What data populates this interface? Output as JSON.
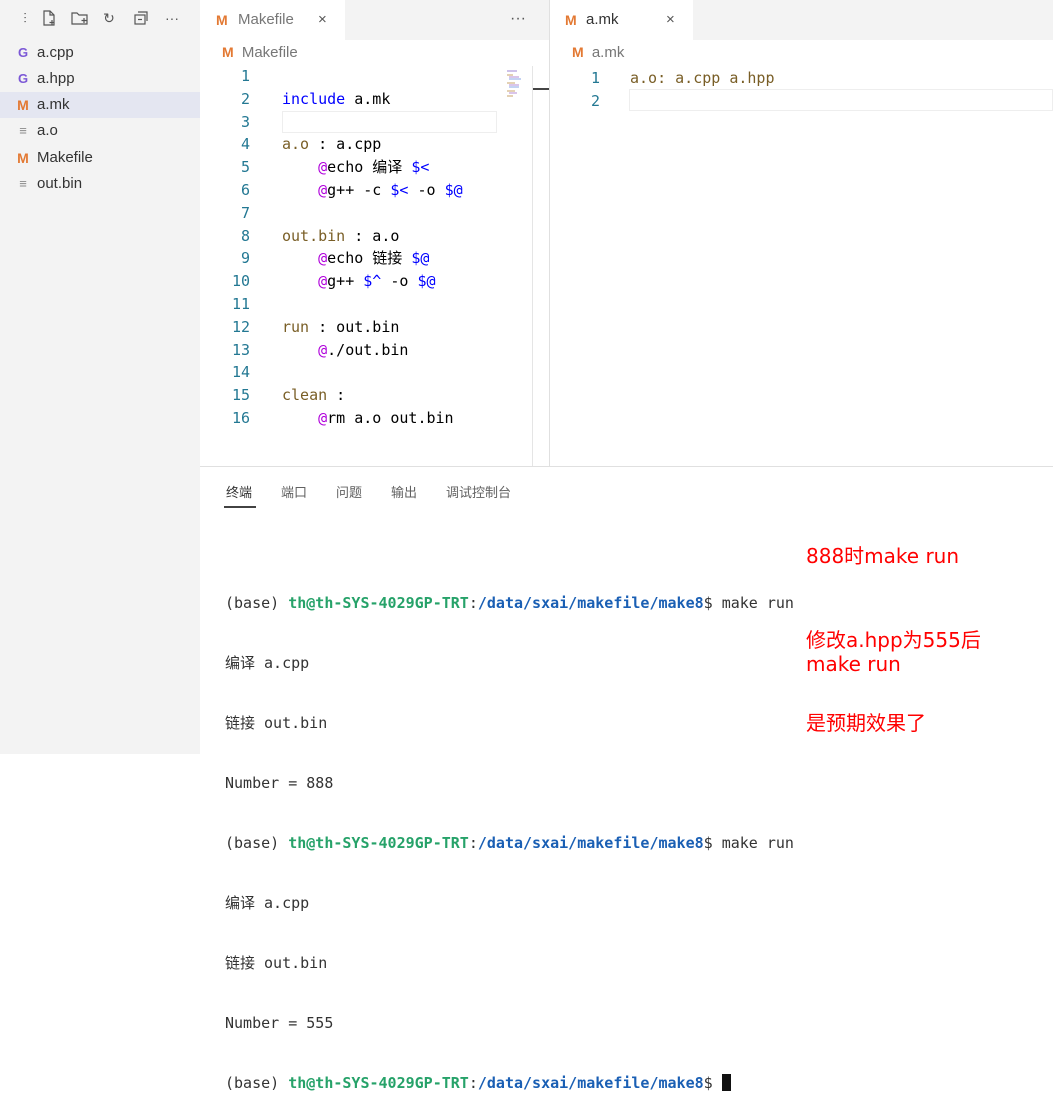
{
  "sidebar": {
    "toolbar_icons": [
      "collapse-icon",
      "new-file-icon",
      "new-folder-icon",
      "refresh-icon",
      "collapse-all-icon",
      "more-icon"
    ],
    "files": [
      {
        "label": "a.cpp",
        "icon": "c",
        "icon_glyph": "G"
      },
      {
        "label": "a.hpp",
        "icon": "c",
        "icon_glyph": "G"
      },
      {
        "label": "a.mk",
        "icon": "m",
        "icon_glyph": "M",
        "selected": true
      },
      {
        "label": "a.o",
        "icon": "t",
        "icon_glyph": "≡"
      },
      {
        "label": "Makefile",
        "icon": "m",
        "icon_glyph": "M"
      },
      {
        "label": "out.bin",
        "icon": "t",
        "icon_glyph": "≡"
      }
    ]
  },
  "editor_left": {
    "tab_label": "Makefile",
    "tab_icon": "M",
    "close_glyph": "×",
    "more_glyph": "···",
    "breadcrumb": "Makefile",
    "line_numbers": [
      "1",
      "2",
      "3",
      "4",
      "5",
      "6",
      "7",
      "8",
      "9",
      "10",
      "11",
      "12",
      "13",
      "14",
      "15",
      "16"
    ]
  },
  "editor_right": {
    "tab_label": "a.mk",
    "tab_icon": "M",
    "close_glyph": "×",
    "breadcrumb": "a.mk",
    "line_numbers": [
      "1",
      "2"
    ],
    "line1": "a.o: a.cpp a.hpp"
  },
  "code_left": [
    [],
    [
      [
        "kw",
        "include"
      ],
      [
        "pl",
        " a.mk"
      ]
    ],
    [],
    [
      [
        "tg",
        "a.o"
      ],
      [
        "pl",
        " : a.cpp"
      ]
    ],
    [
      [
        "pl",
        "    "
      ],
      [
        "at",
        "@"
      ],
      [
        "pl",
        "echo 编译 "
      ],
      [
        "vr",
        "$<"
      ]
    ],
    [
      [
        "pl",
        "    "
      ],
      [
        "at",
        "@"
      ],
      [
        "pl",
        "g++ -c "
      ],
      [
        "vr",
        "$<"
      ],
      [
        "pl",
        " -o "
      ],
      [
        "vr",
        "$@"
      ]
    ],
    [],
    [
      [
        "tg",
        "out.bin"
      ],
      [
        "pl",
        " : a.o"
      ]
    ],
    [
      [
        "pl",
        "    "
      ],
      [
        "at",
        "@"
      ],
      [
        "pl",
        "echo 链接 "
      ],
      [
        "vr",
        "$@"
      ]
    ],
    [
      [
        "pl",
        "    "
      ],
      [
        "at",
        "@"
      ],
      [
        "pl",
        "g++ "
      ],
      [
        "vr",
        "$^"
      ],
      [
        "pl",
        " -o "
      ],
      [
        "vr",
        "$@"
      ]
    ],
    [],
    [
      [
        "tg",
        "run"
      ],
      [
        "pl",
        " : out.bin"
      ]
    ],
    [
      [
        "pl",
        "    "
      ],
      [
        "at",
        "@"
      ],
      [
        "pl",
        "./out.bin"
      ]
    ],
    [],
    [
      [
        "tg",
        "clean"
      ],
      [
        "pl",
        " :"
      ]
    ],
    [
      [
        "pl",
        "    "
      ],
      [
        "at",
        "@"
      ],
      [
        "pl",
        "rm a.o out.bin"
      ]
    ]
  ],
  "panel": {
    "tabs": [
      "终端",
      "端口",
      "问题",
      "输出",
      "调试控制台"
    ],
    "active_tab": "终端"
  },
  "terminal": {
    "prompt_env": "(base) ",
    "prompt_user": "th@th-SYS-4029GP-TRT",
    "prompt_sep": ":",
    "prompt_path": "/data/sxai/makefile/make8",
    "prompt_end": "$",
    "command": " make run",
    "out1": "编译 a.cpp",
    "out2": "链接 out.bin",
    "out3": "Number = 888",
    "out4": "编译 a.cpp",
    "out5": "链接 out.bin",
    "out6": "Number = 555"
  },
  "annotations": {
    "note1": "888时make run",
    "note2a": "修改a.hpp为555后",
    "note2b": "make run",
    "note3": "是预期效果了"
  },
  "colors": {
    "prompt_user": "#26a269",
    "prompt_path": "#1a5fb4",
    "annotation": "#ff0000",
    "makefile_icon": "#e37933"
  }
}
